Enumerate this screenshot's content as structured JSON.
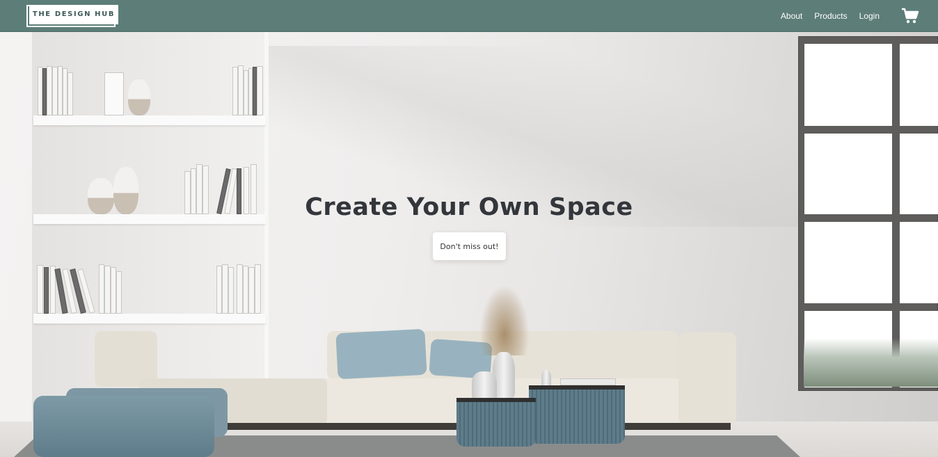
{
  "navbar": {
    "logo_text": "THE DESIGN HUB",
    "links": [
      {
        "label": "About"
      },
      {
        "label": "Products"
      },
      {
        "label": "Login"
      }
    ],
    "cart_icon": "shopping-cart-icon"
  },
  "hero": {
    "title": "Create Your Own Space",
    "cta_label": "Don't miss out!"
  },
  "colors": {
    "navbar_bg": "#5c7d78",
    "accent_blue": "#98b3bf",
    "title_text": "#33363b"
  }
}
